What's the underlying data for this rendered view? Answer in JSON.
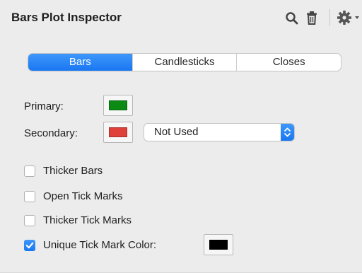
{
  "header": {
    "title": "Bars Plot Inspector",
    "icons": [
      "search-icon",
      "trash-icon",
      "gear-icon",
      "chevron-down-icon"
    ]
  },
  "segments": {
    "items": [
      {
        "label": "Bars",
        "active": true
      },
      {
        "label": "Candlesticks",
        "active": false
      },
      {
        "label": "Closes",
        "active": false
      }
    ]
  },
  "colors": {
    "primary_label": "Primary:",
    "primary_color": "#0b8a14",
    "secondary_label": "Secondary:",
    "secondary_color": "#e0403a",
    "secondary_mode": "Not Used",
    "tick_mark_color": "#000000",
    "accent": "#1f7ff5"
  },
  "options": {
    "thicker_bars": {
      "label": "Thicker Bars",
      "checked": false
    },
    "open_tick_marks": {
      "label": "Open Tick Marks",
      "checked": false
    },
    "thicker_tick_marks": {
      "label": "Thicker Tick Marks",
      "checked": false
    },
    "unique_tick_mark_color": {
      "label": "Unique Tick Mark Color:",
      "checked": true
    }
  }
}
